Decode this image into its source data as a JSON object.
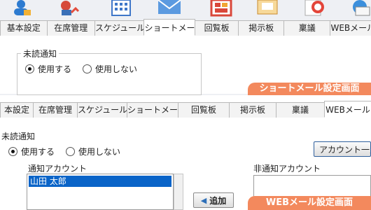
{
  "top_panel": {
    "tabs": [
      "基本設定",
      "在席管理",
      "スケジュール",
      "ショートメール",
      "回覧板",
      "掲示板",
      "稟議",
      "WEBメール"
    ],
    "active_tab": "ショートメール",
    "group_label": "未読通知",
    "radio_on": "使用する",
    "radio_off": "使用しない",
    "banner": "ショートメール設定画面"
  },
  "bottom_panel": {
    "tabs": [
      "本設定",
      "在席管理",
      "スケジュール",
      "ショートメール",
      "回覧板",
      "掲示板",
      "稟議",
      "WEBメール"
    ],
    "active_tab": "WEBメール",
    "group_label": "未読通知",
    "radio_on": "使用する",
    "radio_off": "使用しない",
    "account_list_button": "アカウント一覧",
    "notify_accounts_label": "通知アカウント",
    "non_notify_accounts_label": "非通知アカウント",
    "notify_accounts": [
      "山田 太郎"
    ],
    "add_button": "追加",
    "banner": "WEBメール設定画面"
  },
  "colors": {
    "banner": "#f3895d",
    "selection": "#0a64c8"
  }
}
